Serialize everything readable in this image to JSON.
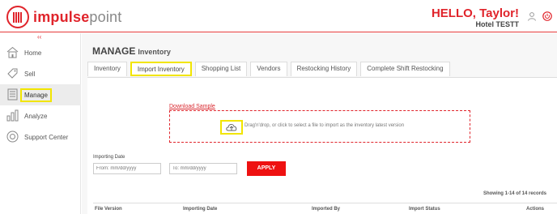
{
  "header": {
    "logo_bold": "impulse",
    "logo_light": "point",
    "greeting": "HELLO, Taylor!",
    "hotel": "Hotel TESTT"
  },
  "sidebar": {
    "collapse": "‹‹",
    "items": [
      {
        "label": "Home",
        "icon": "home-icon"
      },
      {
        "label": "Sell",
        "icon": "sell-icon"
      },
      {
        "label": "Manage",
        "icon": "manage-icon",
        "active": true
      },
      {
        "label": "Analyze",
        "icon": "analyze-icon"
      },
      {
        "label": "Support Center",
        "icon": "support-icon"
      }
    ]
  },
  "main": {
    "title": "MANAGE",
    "subtitle": "Inventory",
    "tabs": [
      {
        "label": "Inventory"
      },
      {
        "label": "Import Inventory",
        "active": true
      },
      {
        "label": "Shopping List"
      },
      {
        "label": "Vendors"
      },
      {
        "label": "Restocking History"
      },
      {
        "label": "Complete Shift Restocking"
      }
    ],
    "download_sample": "Download Sample",
    "dropzone_text": "Drag'n'drop, or click to select a file to import as the inventory latest version",
    "importing_date_label": "Importing Date",
    "from_placeholder": "From: mm/dd/yyyy",
    "to_placeholder": "To: mm/dd/yyyy",
    "apply_label": "APPLY",
    "showing": "Showing 1-14 of 14 records",
    "columns": [
      "File Version",
      "Importing Date",
      "Imported By",
      "Import Status",
      "Actions"
    ]
  },
  "colors": {
    "accent": "#e0242b",
    "highlight": "#f2e500",
    "apply": "#ee1111"
  }
}
